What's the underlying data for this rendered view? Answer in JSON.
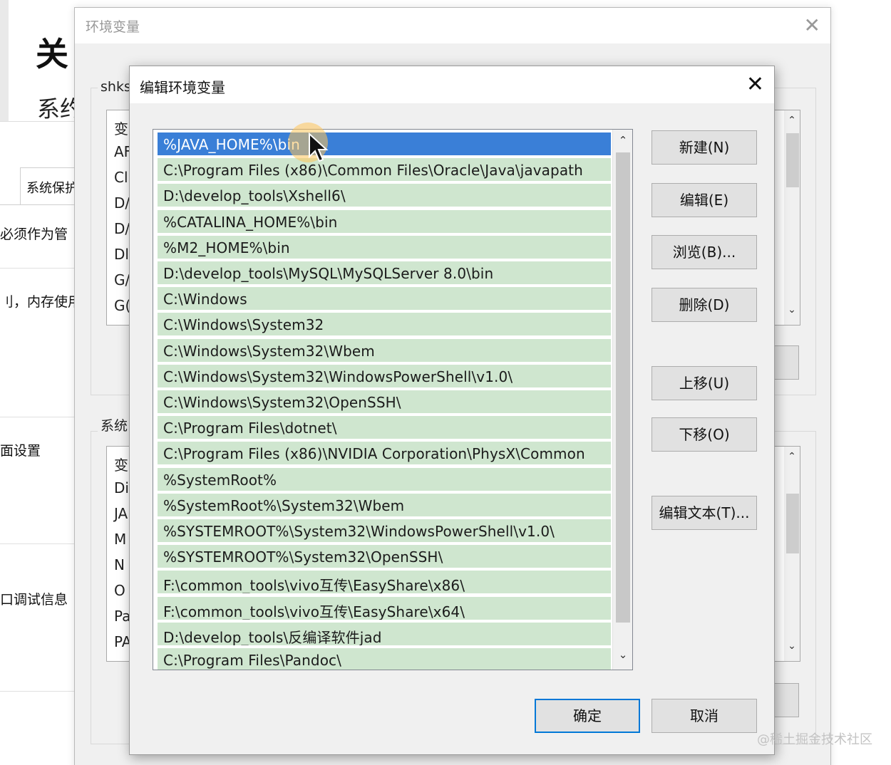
{
  "background": {
    "title": "关",
    "subtitle": "系约",
    "tab_label": "系统保护",
    "texts": [
      "必须作为管",
      "刂，内存使用",
      "面设置",
      "口调试信息"
    ]
  },
  "env_window": {
    "title": "环境变量",
    "user_group_label": "shks",
    "system_group_label": "系统",
    "user_list_rows": [
      "变",
      "AF",
      "Cl",
      "D/",
      "D/",
      "Dl",
      "G/",
      "G("
    ],
    "system_list_rows": [
      "变",
      "Di",
      "JA",
      "M",
      "N",
      "O",
      "Pa",
      "PA"
    ]
  },
  "dialog": {
    "title": "编辑环境变量",
    "selected_index": 0,
    "paths": [
      "%JAVA_HOME%\\bin",
      "C:\\Program Files (x86)\\Common Files\\Oracle\\Java\\javapath",
      "D:\\develop_tools\\Xshell6\\",
      "%CATALINA_HOME%\\bin",
      "%M2_HOME%\\bin",
      "D:\\develop_tools\\MySQL\\MySQLServer 8.0\\bin",
      "C:\\Windows",
      "C:\\Windows\\System32",
      "C:\\Windows\\System32\\Wbem",
      "C:\\Windows\\System32\\WindowsPowerShell\\v1.0\\",
      "C:\\Windows\\System32\\OpenSSH\\",
      "C:\\Program Files\\dotnet\\",
      "C:\\Program Files (x86)\\NVIDIA Corporation\\PhysX\\Common",
      "%SystemRoot%",
      "%SystemRoot%\\System32\\Wbem",
      "%SYSTEMROOT%\\System32\\WindowsPowerShell\\v1.0\\",
      "%SYSTEMROOT%\\System32\\OpenSSH\\",
      "F:\\common_tools\\vivo互传\\EasyShare\\x86\\",
      "F:\\common_tools\\vivo互传\\EasyShare\\x64\\",
      "D:\\develop_tools\\反编译软件jad",
      "C:\\Program Files\\Pandoc\\"
    ],
    "buttons": {
      "new": "新建(N)",
      "edit": "编辑(E)",
      "browse": "浏览(B)...",
      "delete": "删除(D)",
      "move_up": "上移(U)",
      "move_down": "下移(O)",
      "edit_text": "编辑文本(T)...",
      "ok": "确定",
      "cancel": "取消"
    }
  },
  "watermark": "@稀土掘金技术社区",
  "colors": {
    "selection": "#3a7fd7",
    "row_highlight": "#cfe6cf",
    "dialog_bg": "#f0f0f0",
    "primary_border": "#0078d7"
  }
}
